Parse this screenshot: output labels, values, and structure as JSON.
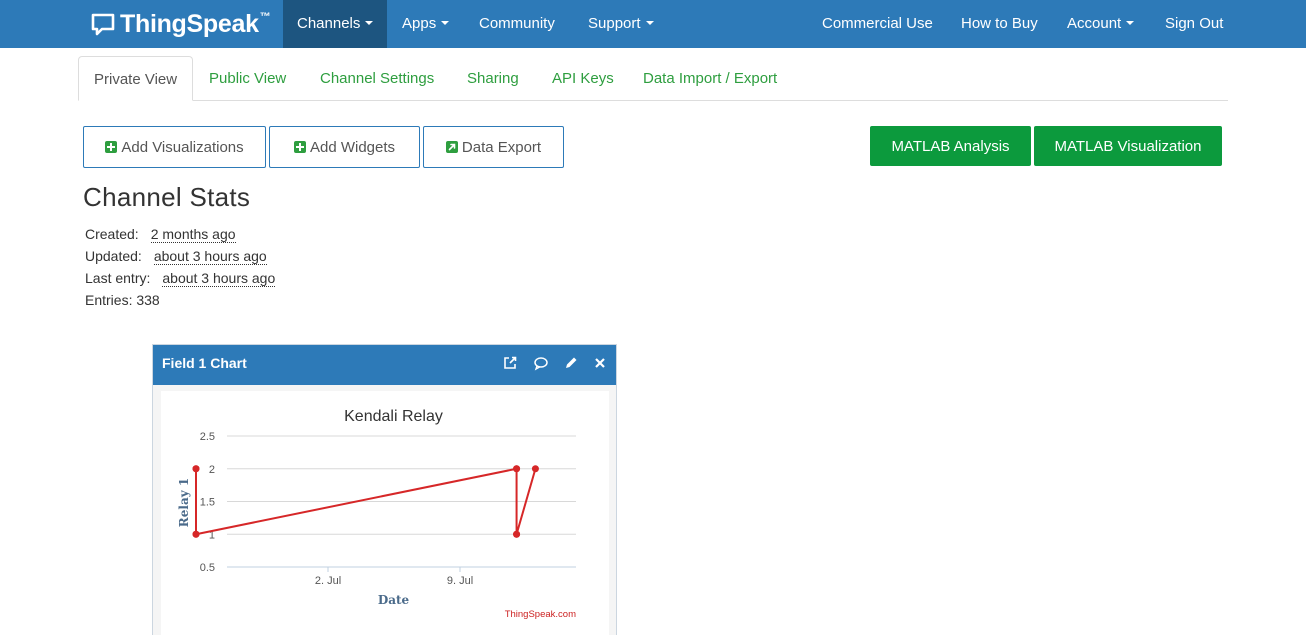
{
  "nav": {
    "brand": "ThingSpeak",
    "brand_tm": "™",
    "left_items": [
      {
        "label": "Channels"
      },
      {
        "label": "Apps"
      },
      {
        "label": "Community"
      },
      {
        "label": "Support"
      }
    ],
    "right_items": [
      {
        "label": "Commercial Use"
      },
      {
        "label": "How to Buy"
      },
      {
        "label": "Account"
      },
      {
        "label": "Sign Out"
      }
    ]
  },
  "tabs": [
    {
      "label": "Private View"
    },
    {
      "label": "Public View"
    },
    {
      "label": "Channel Settings"
    },
    {
      "label": "Sharing"
    },
    {
      "label": "API Keys"
    },
    {
      "label": "Data Import / Export"
    }
  ],
  "buttons": {
    "add_visualizations": "Add Visualizations",
    "add_widgets": "Add Widgets",
    "data_export": "Data Export",
    "matlab_analysis": "MATLAB Analysis",
    "matlab_visualization": "MATLAB Visualization"
  },
  "stats": {
    "title": "Channel Stats",
    "created_label": "Created:",
    "created_value": "2 months ago",
    "updated_label": "Updated:",
    "updated_value": "about 3 hours ago",
    "last_entry_label": "Last entry:",
    "last_entry_value": "about 3 hours ago",
    "entries_label": "Entries:",
    "entries_value": "338"
  },
  "panel": {
    "title": "Field 1 Chart"
  },
  "colors": {
    "nav_bg": "#2d7ab8",
    "nav_active": "#1d5580",
    "green": "#0c9a3d",
    "link_green": "#2e9e3f",
    "series": "#d62728"
  },
  "chart_data": {
    "type": "line",
    "title": "Kendali Relay",
    "xlabel": "Date",
    "ylabel": "Relay 1",
    "credit": "ThingSpeak.com",
    "ylim": [
      0.5,
      2.5
    ],
    "yticks": [
      "2.5",
      "2",
      "1.5",
      "1",
      "0.5"
    ],
    "xticks": [
      "2. Jul",
      "9. Jul"
    ],
    "x_tick_dates": [
      "2 Jul",
      "9 Jul"
    ],
    "grid": true,
    "series": [
      {
        "values": [
          {
            "x": "25 Jun",
            "y": 2
          },
          {
            "x": "25 Jun",
            "y": 1
          },
          {
            "x": "25 Jun",
            "y": 2
          },
          {
            "x": "25 Jun",
            "y": 1
          },
          {
            "x": "12 Jul",
            "y": 2
          },
          {
            "x": "12 Jul",
            "y": 1
          },
          {
            "x": "12 Jul",
            "y": 2
          },
          {
            "x": "12 Jul",
            "y": 1
          },
          {
            "x": "13 Jul",
            "y": 2
          }
        ]
      }
    ]
  }
}
